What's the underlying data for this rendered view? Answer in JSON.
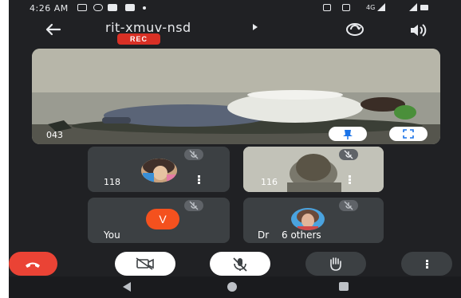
{
  "status_bar": {
    "time": "4:26 AM",
    "network_label": "4G"
  },
  "header": {
    "meeting_code": "rit-xmuv-nsd",
    "rec_badge": "REC"
  },
  "main_tile": {
    "participant_label": "043"
  },
  "tiles": [
    {
      "label": "118"
    },
    {
      "label": "116"
    },
    {
      "label": "You",
      "avatar_letter": "V"
    },
    {
      "label": "Dr",
      "others_label": "6 others"
    }
  ],
  "colors": {
    "background": "#202124",
    "tile": "#3c4043",
    "rec_red": "#d93025",
    "end_call_red": "#ea4335",
    "avatar_orange": "#f4511e",
    "pin_blue": "#1a73e8"
  },
  "icons": {
    "back": "arrow-left-icon",
    "chevron": "chevron-right-icon",
    "switch_camera": "switch-camera-icon",
    "speaker": "speaker-icon",
    "pin": "pin-icon",
    "fullscreen": "fullscreen-icon",
    "mic_off": "mic-off-icon",
    "more": "more-vert-icon",
    "end_call": "call-end-icon",
    "camera_off": "camera-off-icon",
    "raise_hand": "raise-hand-icon"
  }
}
